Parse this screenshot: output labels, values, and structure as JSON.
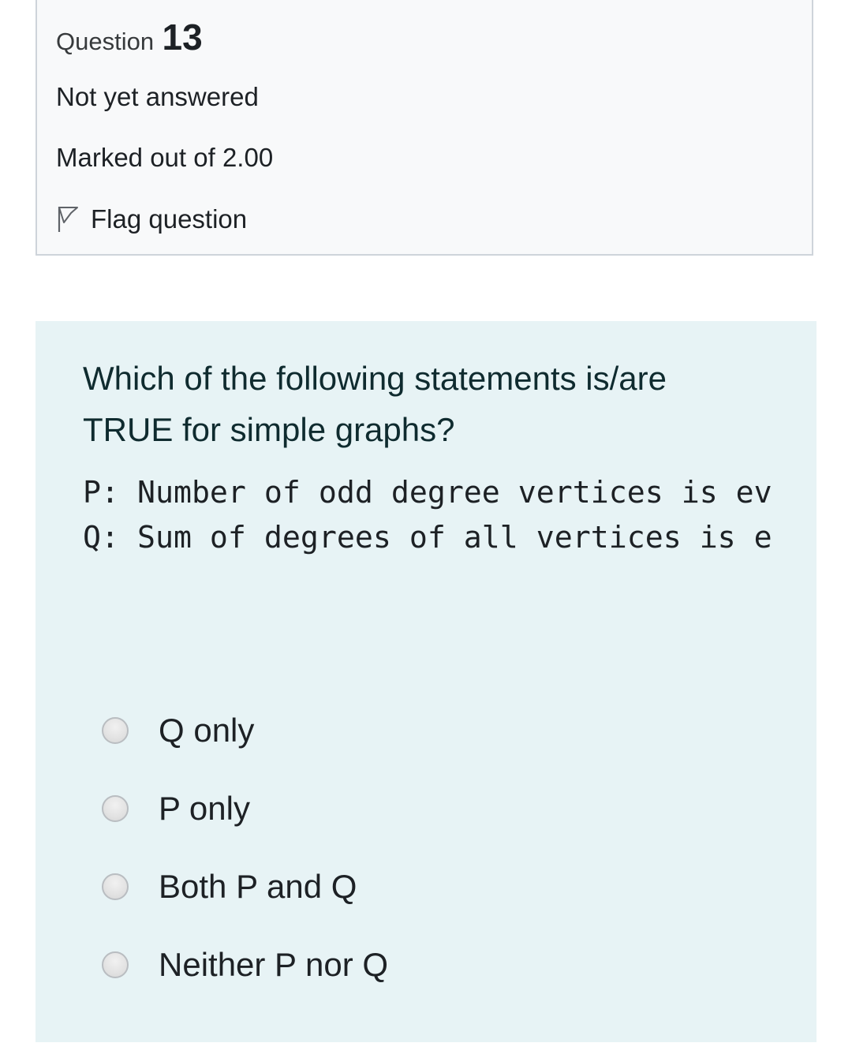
{
  "info": {
    "question_label": "Question",
    "question_number": "13",
    "state": "Not yet answered",
    "grade": "Marked out of 2.00",
    "flag_label": "Flag question",
    "flag_icon": "flag-outline-icon"
  },
  "question": {
    "text": "Which of the following statements is/are TRUE for simple graphs?",
    "statements": [
      "P: Number of odd degree vertices is even",
      "Q: Sum of degrees of all vertices is even"
    ]
  },
  "answers": {
    "options": [
      {
        "label": "Q only",
        "selected": false
      },
      {
        "label": "P only",
        "selected": false
      },
      {
        "label": "Both P and Q",
        "selected": false
      },
      {
        "label": "Neither P nor Q",
        "selected": false
      }
    ]
  },
  "colors": {
    "info_background": "#f8f9fa",
    "info_border": "#ced4da",
    "formulation_background": "#e7f3f5",
    "text": "#1d2125"
  }
}
